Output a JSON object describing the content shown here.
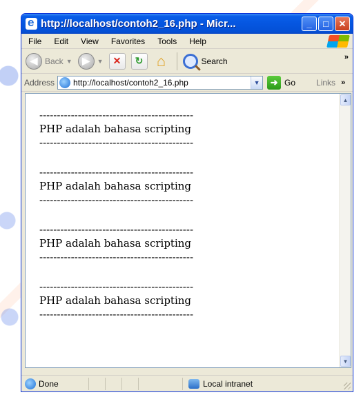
{
  "window": {
    "title": "http://localhost/contoh2_16.php - Micr..."
  },
  "menubar": {
    "items": [
      "File",
      "Edit",
      "View",
      "Favorites",
      "Tools",
      "Help"
    ]
  },
  "toolbar": {
    "back_label": "Back",
    "search_label": "Search"
  },
  "addressbar": {
    "label": "Address",
    "url": "http://localhost/contoh2_16.php",
    "go_label": "Go",
    "links_label": "Links"
  },
  "content": {
    "dash_line": "--------------------------------------------",
    "blocks": [
      {
        "text": "PHP adalah bahasa scripting"
      },
      {
        "text": "PHP adalah bahasa scripting"
      },
      {
        "text": "PHP adalah bahasa scripting"
      },
      {
        "text": "PHP adalah bahasa scripting"
      }
    ]
  },
  "statusbar": {
    "status": "Done",
    "zone": "Local intranet"
  },
  "icons": {
    "title": "ie-icon",
    "back": "back-arrow-icon",
    "forward": "forward-arrow-icon",
    "stop": "stop-icon",
    "refresh": "refresh-icon",
    "home": "home-icon",
    "search": "search-icon",
    "go": "go-arrow-icon",
    "zone": "intranet-icon"
  }
}
